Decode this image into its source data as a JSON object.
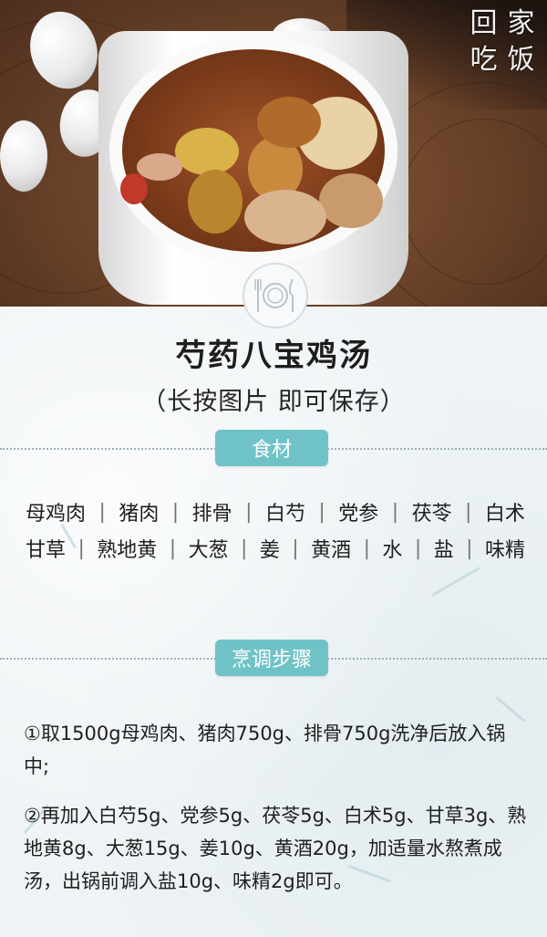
{
  "logo": {
    "chars": [
      "回",
      "家",
      "吃",
      "饭"
    ]
  },
  "title": "芍药八宝鸡汤",
  "subtitle": "（长按图片 即可保存）",
  "ingredients_section": {
    "label": "食材",
    "rows": [
      [
        "母鸡肉",
        "猪肉",
        "排骨",
        "白芍",
        "党参",
        "茯苓",
        "白术"
      ],
      [
        "甘草",
        "熟地黄",
        "大葱",
        "姜",
        "黄酒",
        "水",
        "盐",
        "味精"
      ]
    ],
    "separator": "|"
  },
  "steps_section": {
    "label": "烹调步骤",
    "steps": [
      "①取1500g母鸡肉、猪肉750g、排骨750g洗净后放入锅中;",
      "②再加入白芍5g、党参5g、茯苓5g、白术5g、甘草3g、熟地黄8g、大葱15g、姜10g、黄酒20g，加适量水熬煮成汤，出锅前调入盐10g、味精2g即可。"
    ]
  },
  "colors": {
    "accent": "#6fc3c7",
    "background": "#eef3f5"
  },
  "icons": {
    "plate": "plate-fork-knife-icon"
  }
}
